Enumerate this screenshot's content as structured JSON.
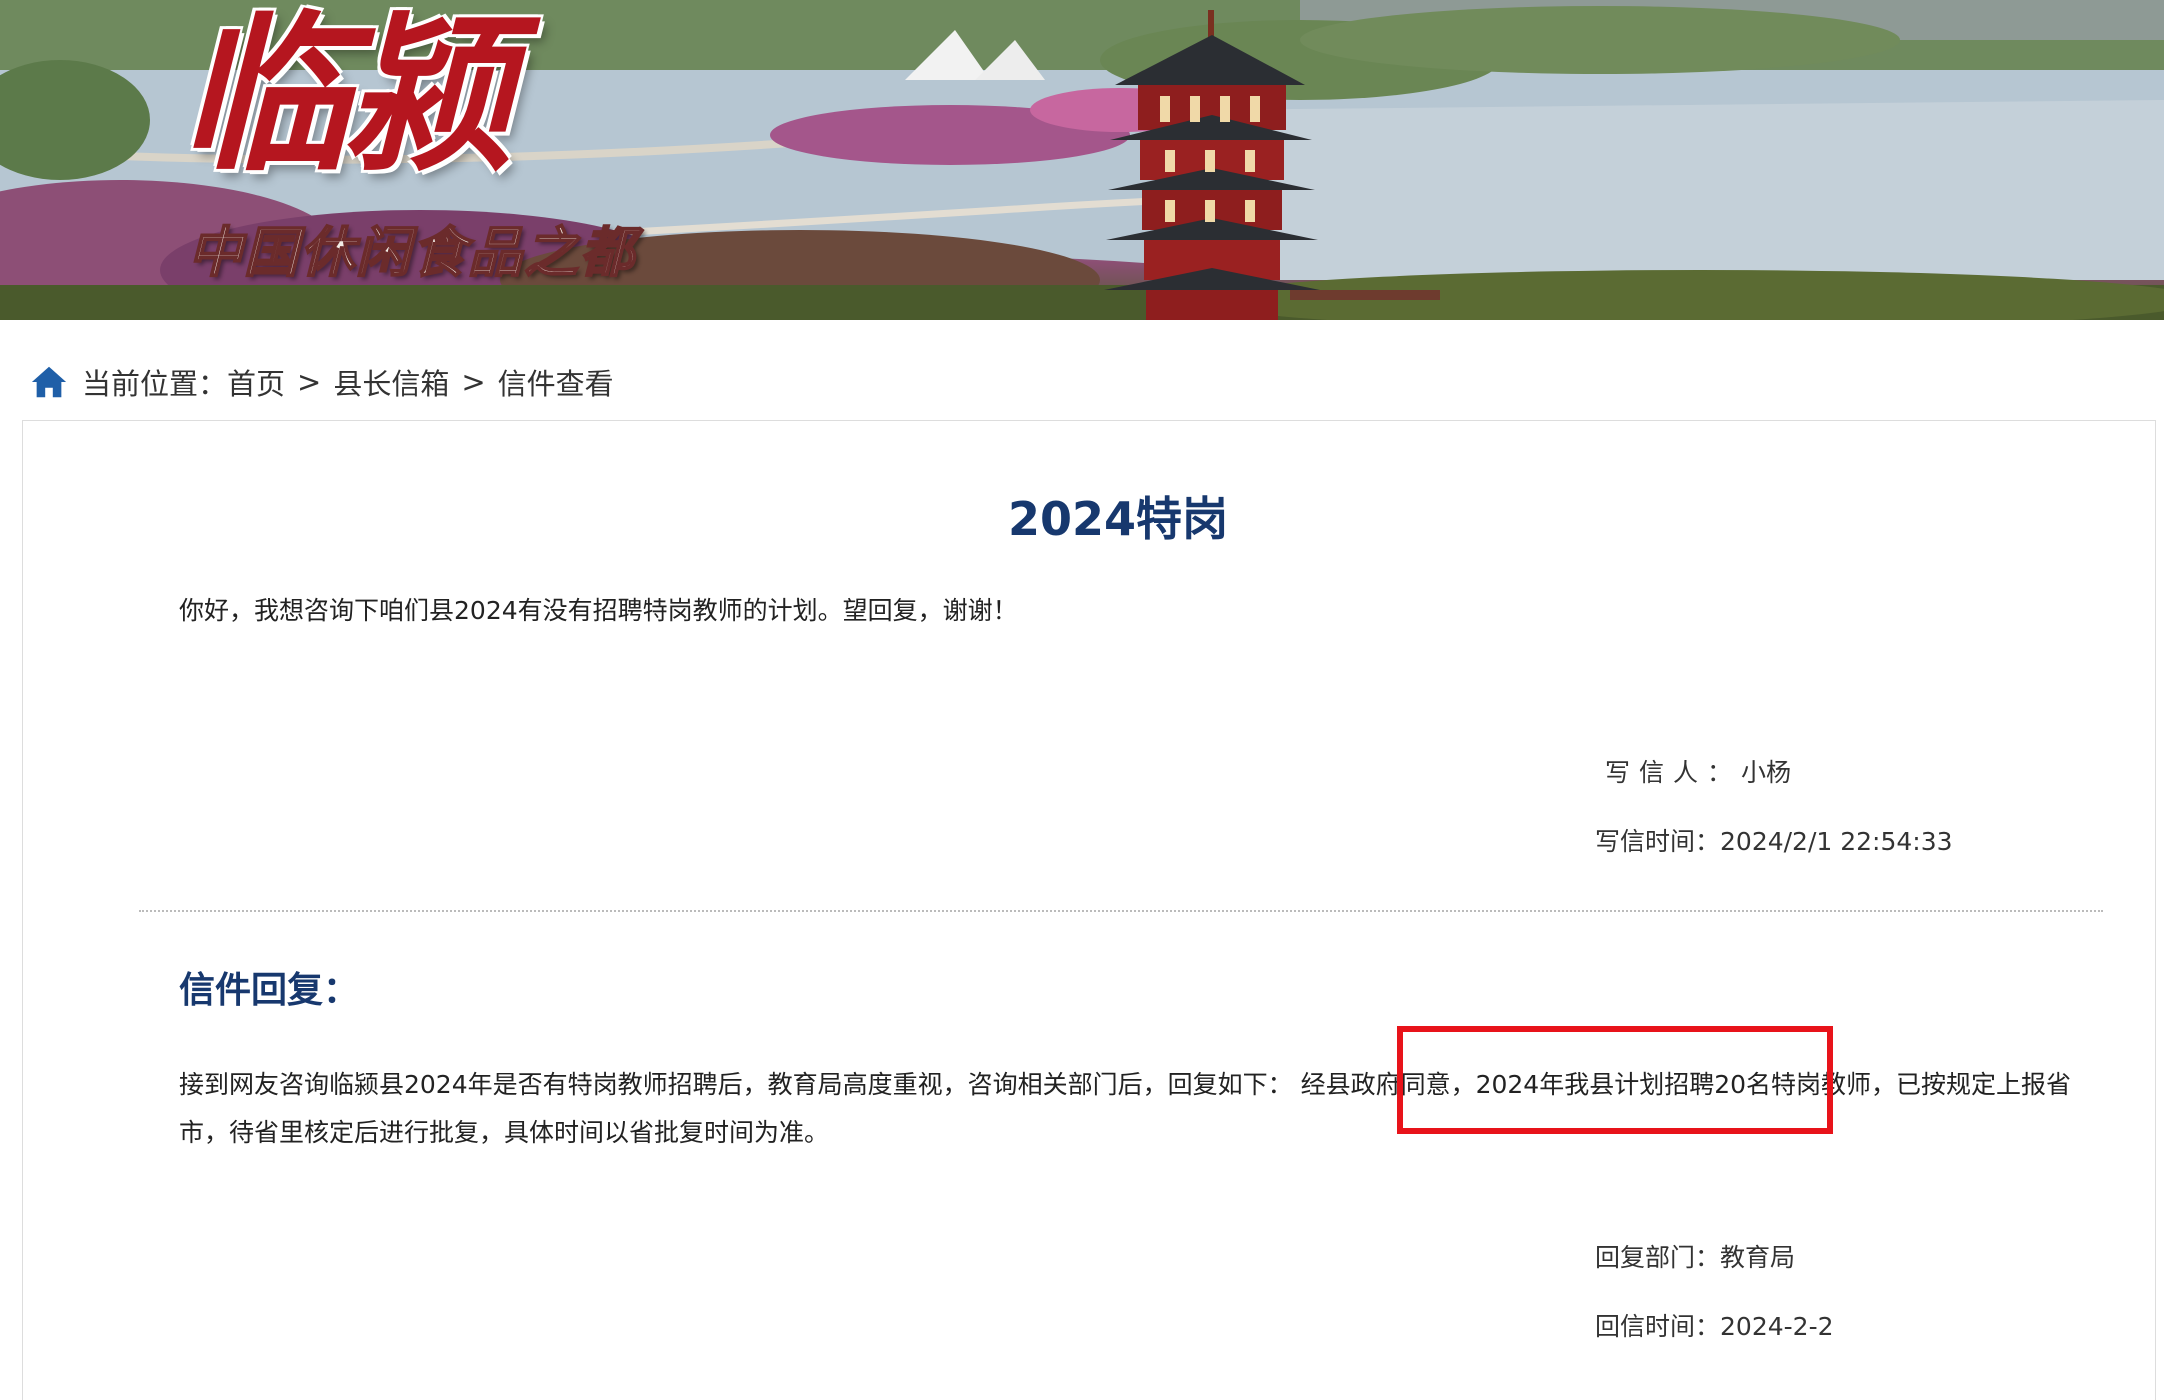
{
  "banner": {
    "logo_text": "临颍",
    "slogan_text": "中国休闲食品之都"
  },
  "breadcrumb": {
    "prefix": "当前位置：",
    "items": [
      "首页",
      "县长信箱",
      "信件查看"
    ],
    "separator": ">"
  },
  "letter": {
    "title": "2024特岗",
    "body": "你好，我想咨询下咱们县2024有没有招聘特岗教师的计划。望回复，谢谢！",
    "writer_label": "写信人：",
    "writer": "小杨",
    "time_label": "写信时间：",
    "time": "2024/2/1 22:54:33"
  },
  "reply": {
    "heading": "信件回复：",
    "body_before": "接到网友咨询临颍县2024年是否有特岗教师招聘后，教育局高度重视，咨询相关部门后，回复如下： 经县政府同意，",
    "body_highlight": "2024年我县计划招聘20名特岗教师",
    "body_after": "，已按规定上报省市，待省里核定后进行批复，具体时间以省批复时间为准。",
    "dept_label": "回复部门：",
    "dept": "教育局",
    "time_label": "回信时间：",
    "time": "2024-2-2"
  },
  "colors": {
    "title_blue": "#17386e",
    "highlight_red": "#e8131a",
    "logo_red": "#b5161f",
    "home_icon_blue": "#1f5fa8"
  },
  "icons": {
    "breadcrumb": "home-icon"
  }
}
